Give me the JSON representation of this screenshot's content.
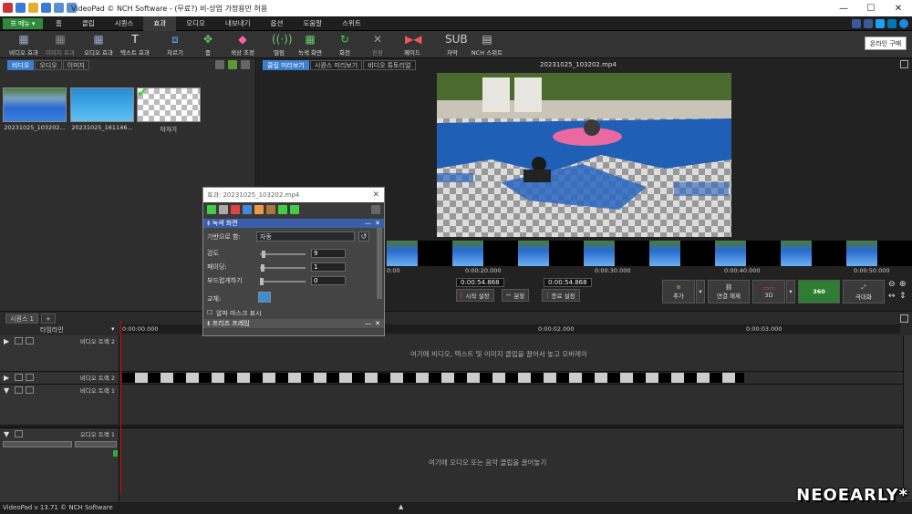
{
  "window": {
    "title": "VideoPad © NCH Software - (무료?) 비-상업 가정용만 허용"
  },
  "menu": {
    "menu_button": "메뉴",
    "tabs": [
      "홈",
      "클립",
      "시퀀스",
      "효과",
      "오디오",
      "내보내기",
      "옵션",
      "도움말",
      "스위트"
    ],
    "active_tab": "효과"
  },
  "toolbar": {
    "items": [
      {
        "label": "비디오 효과",
        "icon": "video-effects-icon"
      },
      {
        "label": "이미지 효과",
        "icon": "image-effects-icon"
      },
      {
        "label": "오디오 효과",
        "icon": "audio-effects-icon"
      },
      {
        "label": "텍스트 효과",
        "icon": "text-effects-icon"
      },
      {
        "label": "자르기",
        "icon": "crop-icon"
      },
      {
        "label": "줌",
        "icon": "zoom-icon"
      },
      {
        "label": "색상 조정",
        "icon": "color-adjust-icon"
      },
      {
        "label": "떨림",
        "icon": "shake-icon"
      },
      {
        "label": "녹색 화면",
        "icon": "green-screen-icon"
      },
      {
        "label": "회전",
        "icon": "rotate-icon"
      },
      {
        "label": "전환",
        "icon": "transition-icon"
      },
      {
        "label": "페이드",
        "icon": "fade-icon"
      },
      {
        "label": "자막",
        "icon": "subtitle-icon"
      },
      {
        "label": "NCH 스위트",
        "icon": "nch-suite-icon"
      }
    ],
    "buy_label": "온라인 구매"
  },
  "media_panel": {
    "tabs": [
      "비디오",
      "오디오",
      "이미지"
    ],
    "active": "비디오",
    "items": [
      {
        "label": "20231025_103202..."
      },
      {
        "label": "20231025_161146..."
      },
      {
        "label": "타자기"
      }
    ]
  },
  "preview": {
    "tabs": [
      "클립 미리보기",
      "시퀀스 미리보기",
      "비디오 튜토리얼"
    ],
    "active": "클립 미리보기",
    "clip_name": "20231025_103202.mp4",
    "ruler_ticks": [
      "0:00",
      "0:00:20.000",
      "0:00:30.000",
      "0:00:40.000",
      "0:00:50.000"
    ],
    "time_current": "0:00:54.868",
    "time_total": "0:00:54.868",
    "set_start": "시작 설정",
    "split": "분할",
    "set_end": "종료 설정",
    "add": "추가",
    "unlink": "연결 해제",
    "three_d": "3D",
    "three_sixty": "360",
    "maximize": "극대화"
  },
  "effect_dialog": {
    "title": "효과: 20231025_103202.mp4",
    "section_green": "녹색 화면",
    "base_color_label": "기반으로 함:",
    "base_color_value": "자동",
    "strength_label": "강도",
    "strength_value": "9",
    "strength_level": 0.05,
    "fade_label": "페이딩:",
    "fade_value": "1",
    "fade_level": 0.02,
    "smooth_label": "부드럽게하기",
    "smooth_value": "0",
    "smooth_level": 0.0,
    "replace_label": "교체:",
    "alpha_mask_label": "알파 마스크 표시",
    "section_keyframe": "프리즈 프레임"
  },
  "timeline": {
    "tabs": [
      "시퀀스 1",
      "+"
    ],
    "label": "타임라인",
    "ruler_ticks": [
      "0:00:00.000",
      "0:00:01.000",
      "0:00:02.000",
      "0:00:03.000"
    ],
    "tracks": {
      "video2": "비디오 트랙 2",
      "video1b": "비디오 트랙 2",
      "video1": "비디오 트랙 1",
      "audio1": "오디오 트랙 1"
    },
    "video_hint": "여기에 비디오, 텍스트 및 이미지 클립을 끌어서 놓고 오버레이",
    "audio_hint": "여기에 오디오 또는 음악 클립을 끌어놓기"
  },
  "status": {
    "text": "VideoPad v 13.71 © NCH Software"
  },
  "watermark": "NEOEARLY*"
}
